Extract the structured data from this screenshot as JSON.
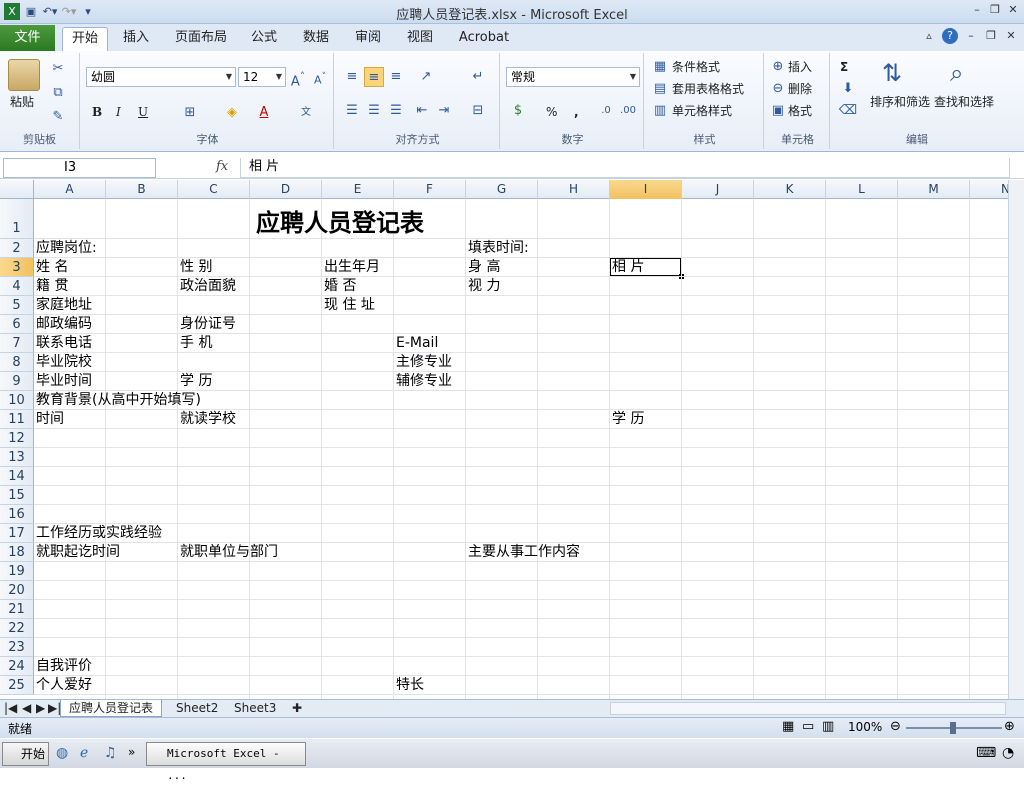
{
  "window": {
    "title": "应聘人员登记表.xlsx - Microsoft Excel"
  },
  "ribbon_tabs": [
    "文件",
    "开始",
    "插入",
    "页面布局",
    "公式",
    "数据",
    "审阅",
    "视图",
    "Acrobat"
  ],
  "ribbon": {
    "clipboard": {
      "paste": "粘贴",
      "label": "剪贴板"
    },
    "font": {
      "name": "幼圆",
      "size": "12",
      "label": "字体",
      "bold": "B",
      "italic": "I",
      "underline": "U"
    },
    "alignment": {
      "label": "对齐方式"
    },
    "number": {
      "format": "常规",
      "label": "数字",
      "percent": "%",
      "comma": ","
    },
    "styles": {
      "conditional": "条件格式",
      "table": "套用表格格式",
      "cell": "单元格样式",
      "label": "样式"
    },
    "cells": {
      "insert": "插入",
      "delete": "删除",
      "format": "格式",
      "label": "单元格"
    },
    "editing": {
      "sigma": "Σ",
      "sort": "排序和筛选",
      "find": "查找和选择",
      "label": "编辑"
    }
  },
  "formula_bar": {
    "namebox": "I3",
    "fx": "fx",
    "value": "相 片"
  },
  "columns": [
    "A",
    "B",
    "C",
    "D",
    "E",
    "F",
    "G",
    "H",
    "I",
    "J",
    "K",
    "L",
    "M",
    "N"
  ],
  "rows": [
    "1",
    "2",
    "3",
    "4",
    "5",
    "6",
    "7",
    "8",
    "9",
    "10",
    "11",
    "12",
    "13",
    "14",
    "15",
    "16",
    "17",
    "18",
    "19",
    "20",
    "21",
    "22",
    "23",
    "24",
    "25"
  ],
  "cells": {
    "title": "应聘人员登记表",
    "A2": "应聘岗位:",
    "G2": "填表时间:",
    "A3": "姓 名",
    "C3": "性 别",
    "E3": "出生年月",
    "G3": "身 高",
    "I3": "相 片",
    "A4": "籍 贯",
    "C4": "政治面貌",
    "E4": "婚 否",
    "G4": "视 力",
    "A5": "家庭地址",
    "E5": "现 住 址",
    "A6": "邮政编码",
    "C6": "身份证号",
    "A7": "联系电话",
    "C7": "手 机",
    "F7": "E-Mail",
    "A8": "毕业院校",
    "F8": "主修专业",
    "A9": "毕业时间",
    "C9": "学 历",
    "F9": "辅修专业",
    "A10": "教育背景(从高中开始填写)",
    "A11": "时间",
    "C11": "就读学校",
    "I11": "学 历",
    "A17": "工作经历或实践经验",
    "A18": "就职起讫时间",
    "C18": "就职单位与部门",
    "G18": "主要从事工作内容",
    "A24": "自我评价",
    "A25": "个人爱好",
    "F25": "特长"
  },
  "sheets": [
    "应聘人员登记表",
    "Sheet2",
    "Sheet3"
  ],
  "status": {
    "ready": "就绪",
    "zoom": "100%"
  },
  "taskbar": {
    "start": "开始",
    "app": "Microsoft Excel - ...",
    "more": "»"
  }
}
